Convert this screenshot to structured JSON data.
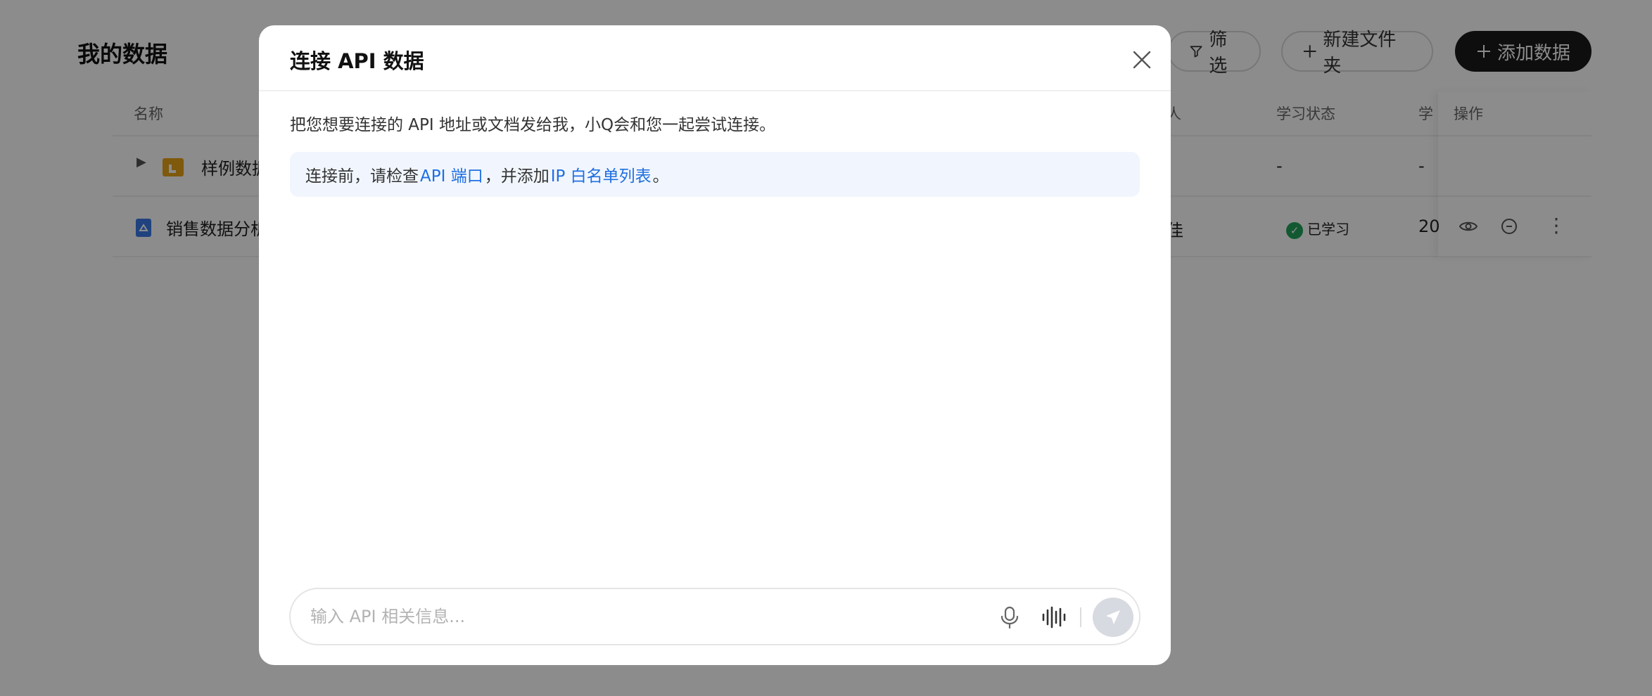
{
  "page": {
    "title": "我的数据",
    "buttons": {
      "filter": "筛选",
      "new_folder": "新建文件夹",
      "add_data": "添加数据"
    },
    "table": {
      "headers": {
        "name": "名称",
        "owner": "人",
        "learn_status": "学习状态",
        "learn_time": "学",
        "actions": "操作"
      },
      "rows": [
        {
          "name": "样例数据",
          "owner": "",
          "status": "-",
          "time": "-"
        },
        {
          "name": "销售数据分析",
          "owner": "佳",
          "status": "已学习",
          "time": "20"
        }
      ]
    }
  },
  "modal": {
    "title": "连接 API 数据",
    "description": "把您想要连接的 API 地址或文档发给我，小Q会和您一起尝试连接。",
    "notice": {
      "prefix": "连接前，请检查",
      "link1": "API 端口",
      "middle": "，并添加",
      "link2": "IP 白名单列表",
      "suffix": "。"
    },
    "input": {
      "placeholder": "输入 API 相关信息...",
      "value": ""
    }
  },
  "colors": {
    "link": "#1f6fe0",
    "notice_bg": "#f1f6fe",
    "status_ok": "#22a35a",
    "primary_btn": "#1a1a1a",
    "send_disabled": "#d7dae0"
  }
}
